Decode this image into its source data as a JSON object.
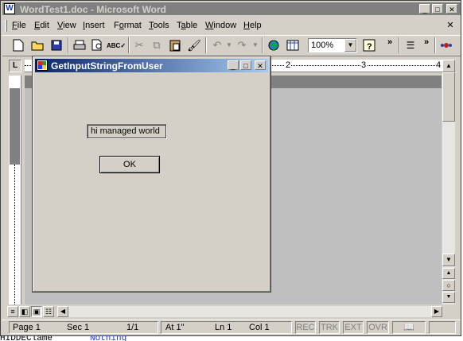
{
  "window": {
    "title": "WordTest1.doc - Microsoft Word"
  },
  "menu": [
    "File",
    "Edit",
    "View",
    "Insert",
    "Format",
    "Tools",
    "Table",
    "Window",
    "Help"
  ],
  "menu_mnemonics": [
    "F",
    "E",
    "V",
    "I",
    "o",
    "T",
    "a",
    "W",
    "H"
  ],
  "toolbar": {
    "zoom": "100%"
  },
  "ruler": {
    "marks": [
      "2",
      "3",
      "4"
    ]
  },
  "statusbar": {
    "page": "Page 1",
    "sec": "Sec 1",
    "pages": "1/1",
    "at": "At 1\"",
    "ln": "Ln 1",
    "col": "Col 1",
    "rec": "REC",
    "trk": "TRK",
    "ext": "EXT",
    "ovr": "OVR"
  },
  "dialog": {
    "title": "GetInputStringFromUser",
    "input_value": "hi managed world",
    "ok_label": "OK"
  },
  "background_text": {
    "left": "HIDDEClame",
    "right": "Nothing"
  },
  "colors": {
    "title_inactive": "#808080",
    "dialog_title_start": "#0a246a",
    "dialog_title_end": "#a6caf0",
    "face": "#d4d0c8",
    "document": "#ffffff"
  }
}
